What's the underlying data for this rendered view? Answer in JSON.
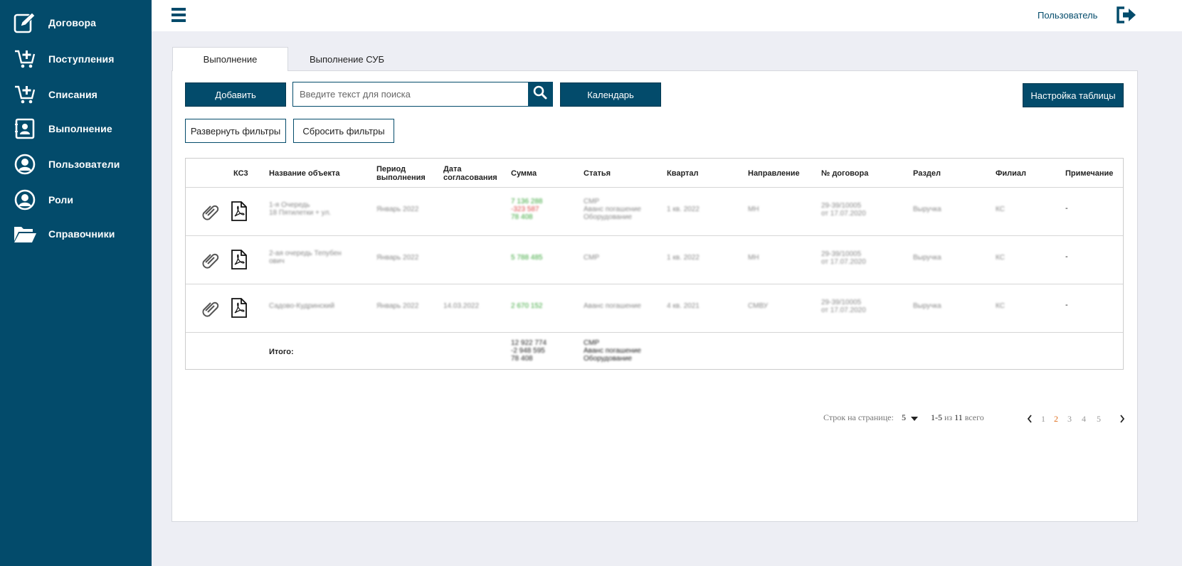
{
  "sidebar": {
    "items": [
      {
        "label": "Договора",
        "icon": "edit-document-icon"
      },
      {
        "label": "Поступления",
        "icon": "cart-plus-icon"
      },
      {
        "label": "Списания",
        "icon": "cart-plus-icon"
      },
      {
        "label": "Выполнение",
        "icon": "contact-book-icon"
      },
      {
        "label": "Пользователи",
        "icon": "user-circle-icon"
      },
      {
        "label": "Роли",
        "icon": "user-circle-icon"
      },
      {
        "label": "Справочники",
        "icon": "folder-open-icon"
      }
    ]
  },
  "header": {
    "user": "Пользователь",
    "menu_icon": "hamburger-icon",
    "logout_icon": "logout-icon"
  },
  "tabs": [
    {
      "label": "Выполнение",
      "active": true
    },
    {
      "label": "Выполнение СУБ",
      "active": false
    }
  ],
  "toolbar": {
    "add": "Добавить",
    "search_placeholder": "Введите текст для поиска",
    "calendar": "Календарь",
    "table_settings": "Настройка таблицы",
    "expand_filters": "Развернуть фильтры",
    "reset_filters": "Сбросить фильтры"
  },
  "table": {
    "headers": {
      "ks3": "КС3",
      "object_name": "Название объекта",
      "period_1": "Период",
      "period_2": "выполнения",
      "date_1": "Дата",
      "date_2": "согласования",
      "sum": "Сумма",
      "article": "Статья",
      "quarter": "Квартал",
      "direction": "Направление",
      "contract_no": "№ договора",
      "section": "Раздел",
      "branch": "Филиал",
      "note": "Примечание"
    },
    "rows": [
      {
        "name_1": "1-я Очередь",
        "name_2": "18 Пятилетки + ул.",
        "period": "Январь 2022",
        "date": "",
        "sum_1": "7 136 288",
        "sum_2": "-323 587",
        "sum_3": "78 408",
        "article_1": "СМР",
        "article_2": "Аванс погашение",
        "article_3": "Оборудование",
        "quarter": "1 кв. 2022",
        "direction": "МН",
        "contract_1": "29-39/10005",
        "contract_2": "от 17.07.2020",
        "section": "Выручка",
        "branch": "КС",
        "note": "-"
      },
      {
        "name_1": "2-ая очередь Тепубен",
        "name_2": "ович",
        "period": "Январь 2022",
        "date": "",
        "sum_1": "5 788 485",
        "article_1": "СМР",
        "quarter": "1 кв. 2022",
        "direction": "МН",
        "contract_1": "29-39/10005",
        "contract_2": "от 17.07.2020",
        "section": "Выручка",
        "branch": "КС",
        "note": "-"
      },
      {
        "name_1": "Садово-Кудринский",
        "period": "Январь 2022",
        "date": "14.03.2022",
        "sum_1": "2 670 152",
        "article_1": "Аванс погашение",
        "quarter": "4 кв. 2021",
        "direction": "СМВУ",
        "contract_1": "29-39/10005",
        "contract_2": "от 17.07.2020",
        "section": "Выручка",
        "branch": "КС",
        "note": "-"
      }
    ],
    "totals": {
      "label": "Итого:",
      "sum_1": "12 922 774",
      "sum_2": "-2 948 595",
      "sum_3": "78 408",
      "article_1": "СМР",
      "article_2": "Аванс погашение",
      "article_3": "Оборудование"
    }
  },
  "pagination": {
    "rows_label": "Строк на странице:",
    "rows_value": "5",
    "range": "1-5",
    "of": "из",
    "total": "11",
    "total_suffix": "всего",
    "pages": [
      "1",
      "2",
      "3",
      "4",
      "5"
    ],
    "current_page": "2"
  },
  "colors": {
    "sidebar": "#034b6b",
    "accent": "#034b6b",
    "positive": "#3aa63a",
    "negative": "#dd4444",
    "current_page": "#e07020"
  }
}
